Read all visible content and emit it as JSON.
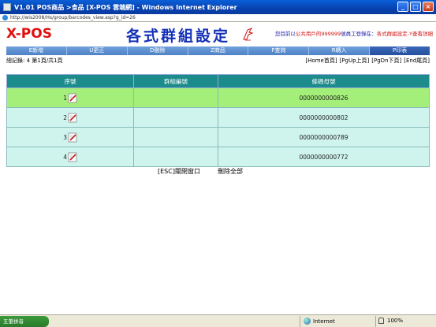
{
  "window": {
    "title": "V1.01 POS商品 >食品 [X-POS 雲端網] - Windows Internet Explorer",
    "url": "http://wis2008/Hs/group/barcodes_view.asp?g_id=26"
  },
  "header": {
    "logo": "X-POS",
    "page_title": "各式群組設定",
    "user_info_prefix": "您目前以",
    "user_info_mid": "公共用戶的999999",
    "user_info_suffix": "號員工登錄在：",
    "location": "各式群組設定-Y查看詳細"
  },
  "menu": [
    {
      "label": "E新增",
      "active": false
    },
    {
      "label": "U更正",
      "active": false
    },
    {
      "label": "D刪除",
      "active": false
    },
    {
      "label": "Z商品",
      "active": false
    },
    {
      "label": "F查詢",
      "active": false
    },
    {
      "label": "R轉入",
      "active": false
    },
    {
      "label": "P印表",
      "active": true
    }
  ],
  "info": {
    "summary": "總記錄: 4  第1頁/共1頁",
    "pager": [
      "[Home首頁]",
      "[PgUp上頁]",
      "[PgDn下頁]",
      "[End尾頁]"
    ]
  },
  "table": {
    "headers": [
      "序號",
      "群組編號",
      "條碼母號"
    ],
    "rows": [
      {
        "seq": "1",
        "group": "",
        "barcode": "0000000000826",
        "selected": true
      },
      {
        "seq": "2",
        "group": "",
        "barcode": "0000000000802",
        "selected": false
      },
      {
        "seq": "3",
        "group": "",
        "barcode": "0000000000789",
        "selected": false
      },
      {
        "seq": "4",
        "group": "",
        "barcode": "0000000000772",
        "selected": false
      }
    ]
  },
  "actions": {
    "close": "[ESC]關閉窗口",
    "delete_all": "刪除全部"
  },
  "statusbar": {
    "taskbar_label": "五筆拼音",
    "zone": "Internet",
    "zoom": "100%"
  },
  "colors": {
    "accent": "#1b8b8b",
    "selected_row": "#a4ee7a",
    "row": "#cff4ee",
    "menu": "#5b8fd0"
  }
}
